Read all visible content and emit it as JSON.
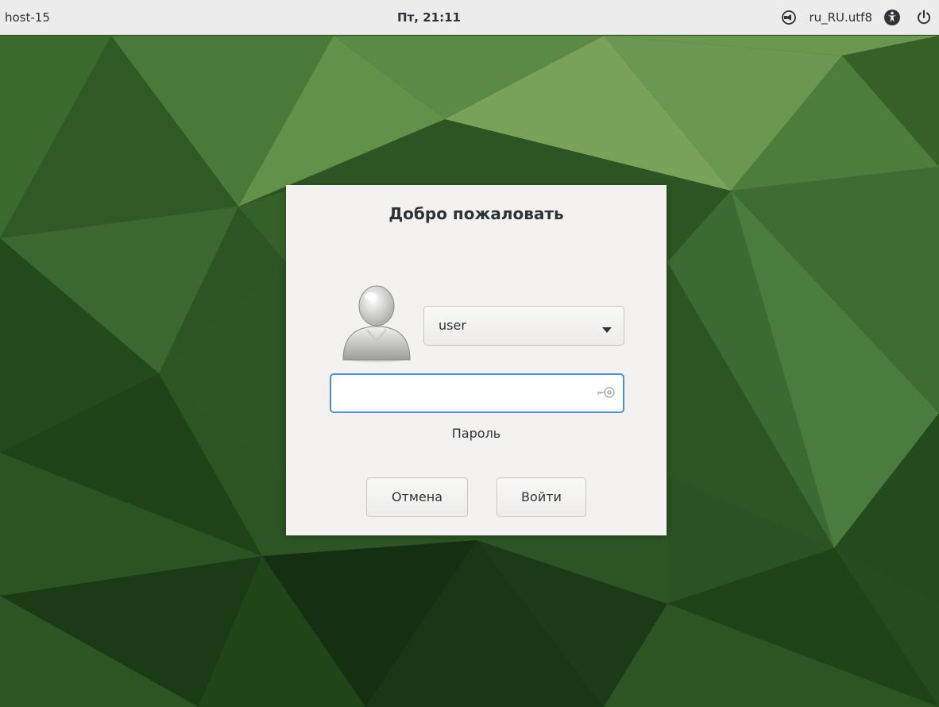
{
  "topbar": {
    "hostname": "host-15",
    "clock": "Пт, 21:11",
    "locale": "ru_RU.utf8",
    "icons": [
      "session-icon",
      "accessibility-icon",
      "power-icon"
    ]
  },
  "dialog": {
    "title": "Добро пожаловать",
    "avatar_icon": "user-avatar-icon",
    "user_select": {
      "value": "user",
      "icon": "dropdown-arrow-icon"
    },
    "password": {
      "value": "",
      "label": "Пароль",
      "icon": "key-icon"
    },
    "buttons": {
      "cancel": "Отмена",
      "login": "Войти"
    }
  },
  "colors": {
    "accent": "#4a90d9",
    "dialog_bg": "#f3f2f1",
    "topbar_bg": "#ececec",
    "wallpaper_dark": "#1f3d18",
    "wallpaper_light": "#7aa15a"
  }
}
